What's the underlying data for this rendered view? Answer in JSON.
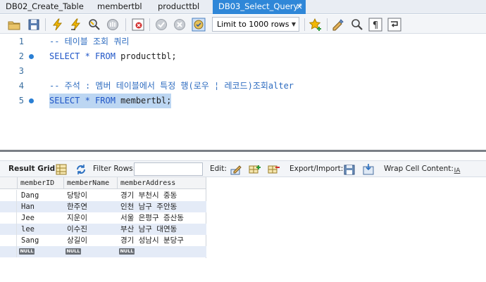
{
  "tabs": [
    {
      "label": "DB02_Create_Table"
    },
    {
      "label": "membertbl"
    },
    {
      "label": "producttbl"
    },
    {
      "label": "DB03_Select_Query*"
    }
  ],
  "tab_close_glyph": "×",
  "toolbar": {
    "limit_select_value": "Limit to 1000 rows",
    "icons": [
      "open-folder-icon",
      "save-icon",
      "execute-icon",
      "execute-line-icon",
      "explain-icon",
      "stop-icon",
      "toggle-error-icon",
      "commit-icon",
      "rollback-icon",
      "autocommit-icon",
      "bookmark-star-icon",
      "beautify-icon",
      "find-icon",
      "invisible-chars-icon",
      "wrap-icon"
    ]
  },
  "editor": {
    "lines": [
      {
        "num": "1",
        "marker": false,
        "parts": [
          {
            "cls": "cm",
            "text": "-- 테이블 조회 쿼리"
          }
        ]
      },
      {
        "num": "2",
        "marker": true,
        "parts": [
          {
            "cls": "kw",
            "text": "SELECT * FROM "
          },
          {
            "cls": "tx",
            "text": "producttbl;"
          }
        ]
      },
      {
        "num": "3",
        "marker": false,
        "parts": []
      },
      {
        "num": "4",
        "marker": false,
        "parts": [
          {
            "cls": "cm",
            "text": "-- 주석 : 멤버 테이블에서 특정 행(로우 ¦ 레코드)조회alter"
          }
        ]
      },
      {
        "num": "5",
        "marker": true,
        "selected": true,
        "parts": [
          {
            "cls": "kw",
            "text": "SELECT * FROM "
          },
          {
            "cls": "tx",
            "text": "membertbl;"
          }
        ]
      }
    ]
  },
  "result_toolbar": {
    "result_grid_label": "Result Grid",
    "filter_rows_label": "Filter Rows:",
    "filter_value": "",
    "edit_label": "Edit:",
    "export_import_label": "Export/Import:",
    "wrap_cell_label": "Wrap Cell Content:",
    "wrap_icon_glyph": "IA"
  },
  "grid": {
    "columns": [
      "memberID",
      "memberName",
      "memberAddress"
    ],
    "rows": [
      [
        "Dang",
        "당탕이",
        "경기 부천시 중동"
      ],
      [
        "Han",
        "한주연",
        "인천 남구 주안동"
      ],
      [
        "Jee",
        "지운이",
        "서울 은평구 증산동"
      ],
      [
        "lee",
        "이수진",
        "부산 남구 대연동"
      ],
      [
        "Sang",
        "상길이",
        "경기 성남시 분당구"
      ]
    ],
    "null_label": "NULL"
  },
  "colors": {
    "active_tab": "#2f87d8",
    "keyword": "#1f55c7",
    "comment": "#2e6cc0",
    "selection": "#bcd6f2",
    "alt_row": "#e4ebf7"
  }
}
